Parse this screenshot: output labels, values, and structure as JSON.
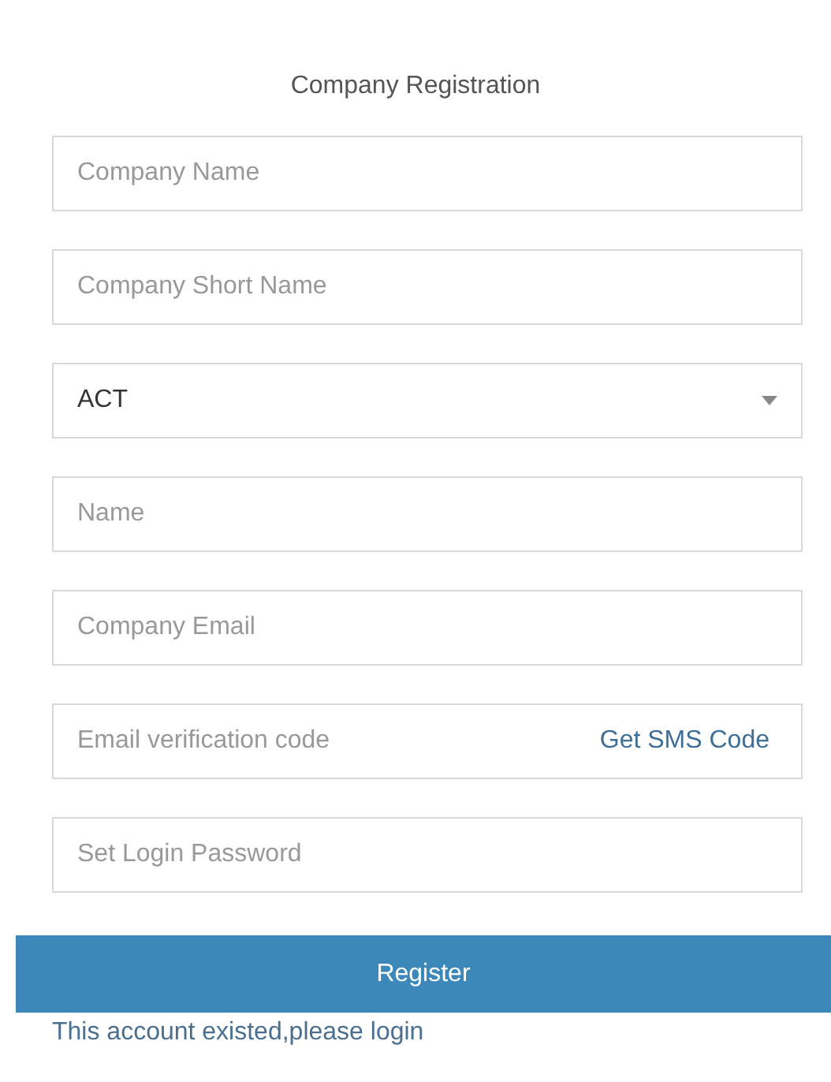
{
  "title": "Company Registration",
  "fields": [
    {
      "kind": "text",
      "placeholder": "Company Name"
    },
    {
      "kind": "text",
      "placeholder": "Company Short Name"
    },
    {
      "kind": "select",
      "value": "ACT"
    },
    {
      "kind": "text",
      "placeholder": "Name"
    },
    {
      "kind": "text",
      "placeholder": "Company Email"
    },
    {
      "kind": "code",
      "placeholder": "Email verification code",
      "action": "Get SMS Code"
    },
    {
      "kind": "text",
      "placeholder": "Set Login Password"
    }
  ],
  "submit": "Register",
  "login_link": "This account existed,please login"
}
